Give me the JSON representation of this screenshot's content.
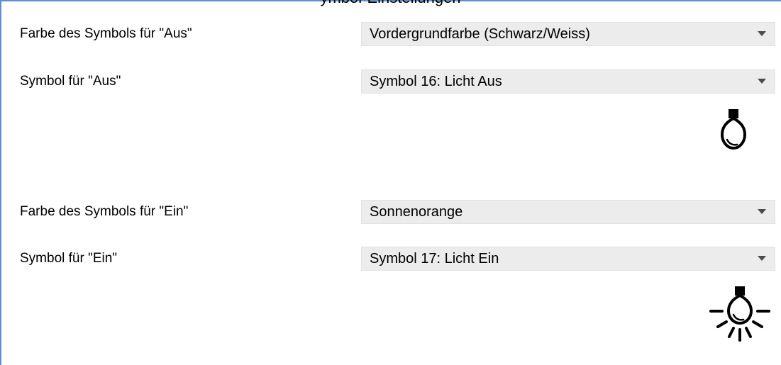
{
  "header": {
    "title_fragment": "ymbol-Einstellungen"
  },
  "settings": {
    "rows": [
      {
        "label": "Farbe des Symbols für \"Aus\"",
        "value": "Vordergrundfarbe (Schwarz/Weiss)"
      },
      {
        "label": "Symbol für \"Aus\"",
        "value": "Symbol 16: Licht Aus"
      },
      {
        "label": "Farbe des Symbols für \"Ein\"",
        "value": "Sonnenorange"
      },
      {
        "label": "Symbol für \"Ein\"",
        "value": "Symbol 17: Licht Ein"
      }
    ]
  },
  "previews": {
    "off_icon": "light-bulb-off-icon",
    "on_icon": "light-bulb-on-icon"
  },
  "colors": {
    "frame_border": "#5d8fd1",
    "dropdown_background": "#ececec",
    "dropdown_arrow": "#4a4a4a",
    "text": "#000000"
  }
}
